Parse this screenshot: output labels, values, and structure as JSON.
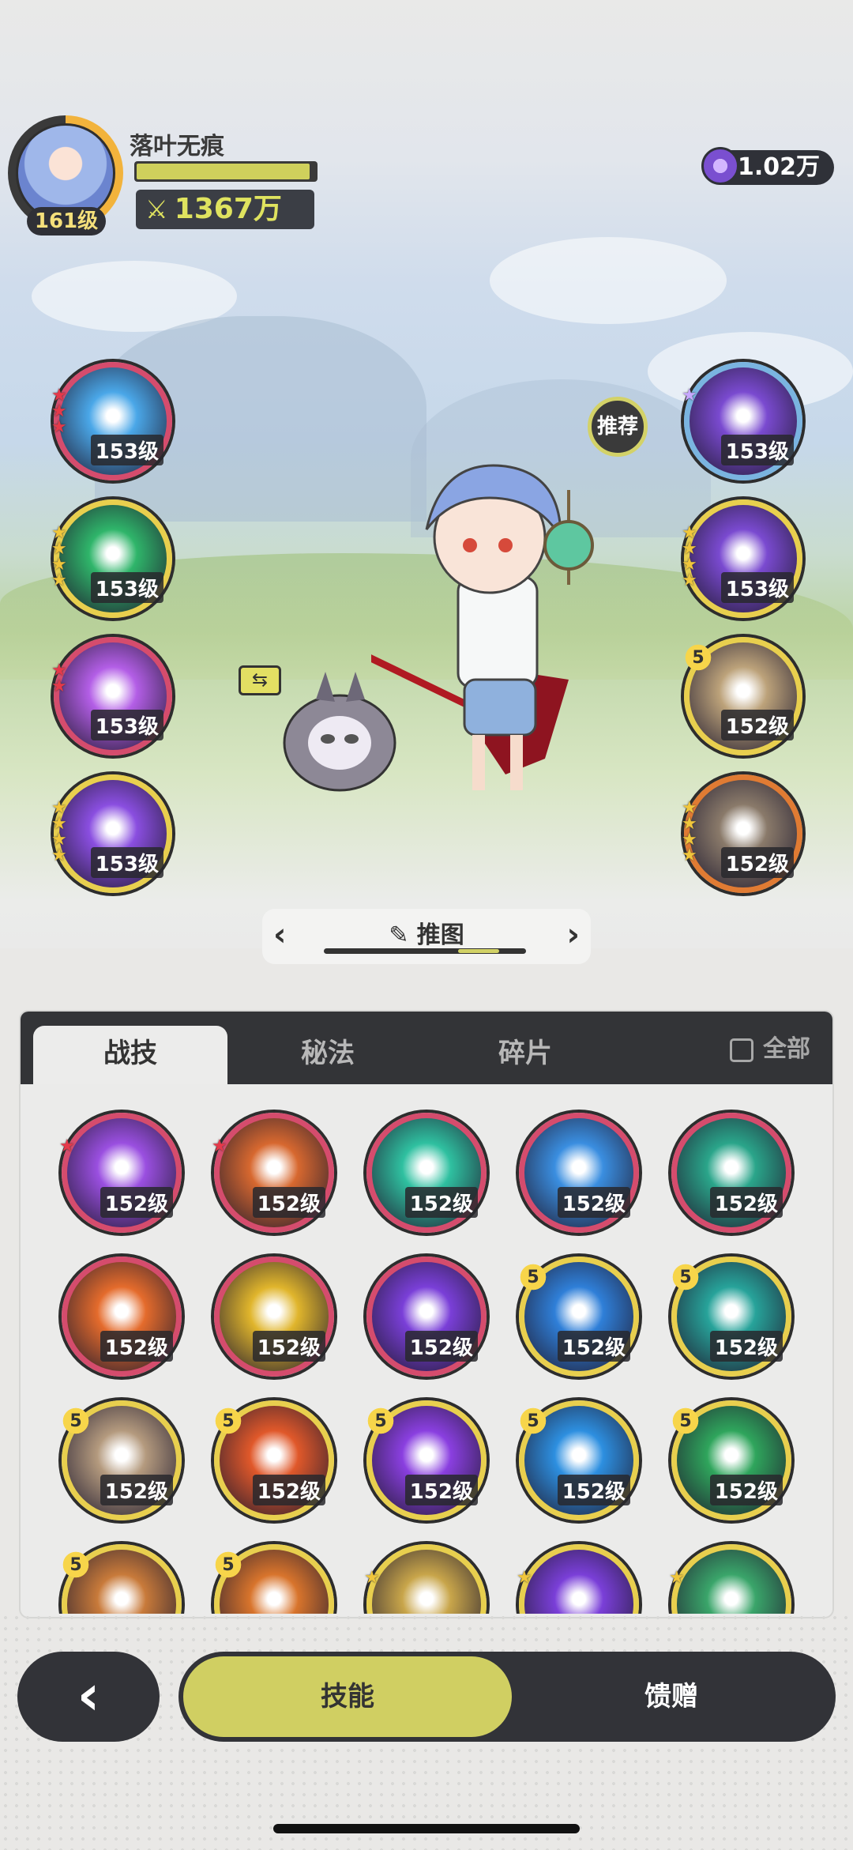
{
  "player": {
    "name": "落叶无痕",
    "level": "161级",
    "power": "1367万",
    "hp_fraction": 0.97
  },
  "currency": {
    "amount": "1.02万",
    "icon": "crystal-icon"
  },
  "recommend_label": "推荐",
  "left_skills": [
    {
      "level": "153级",
      "stars": 3,
      "star_color": "red",
      "frame": "red",
      "theme": "#4aa7e8"
    },
    {
      "level": "153级",
      "stars": 4,
      "star_color": "gold",
      "frame": "gold",
      "theme": "#2fb56a"
    },
    {
      "level": "153级",
      "stars": 2,
      "star_color": "red",
      "frame": "red",
      "theme": "#b35ee6"
    },
    {
      "level": "153级",
      "stars": 4,
      "star_color": "gold",
      "frame": "gold",
      "theme": "#8a4ee0"
    }
  ],
  "right_skills": [
    {
      "level": "153级",
      "stars": 1,
      "star_color": "purple",
      "frame": "blue",
      "theme": "#7a4ad0"
    },
    {
      "level": "153级",
      "stars": 4,
      "star_color": "gold",
      "frame": "gold",
      "theme": "#7a4ad0"
    },
    {
      "level": "152级",
      "stars": 5,
      "star_color": "gold",
      "frame": "gold",
      "theme": "#bca27a",
      "badge": "5"
    },
    {
      "level": "152级",
      "stars": 4,
      "star_color": "gold",
      "frame": "orange",
      "theme": "#8a7a6a"
    }
  ],
  "page_switch": {
    "title": "推图",
    "edit_icon": "pencil-icon"
  },
  "panel": {
    "tabs": [
      "战技",
      "秘法",
      "碎片"
    ],
    "active_tab": 0,
    "all_label": "全部",
    "grid": [
      {
        "level": "152级",
        "frame": "red",
        "theme": "#9a4fe0",
        "stars": 1,
        "star_color": "red"
      },
      {
        "level": "152级",
        "frame": "red",
        "theme": "#d7682f",
        "stars": 1,
        "star_color": "red"
      },
      {
        "level": "152级",
        "frame": "red",
        "theme": "#2fc0a0"
      },
      {
        "level": "152级",
        "frame": "red",
        "theme": "#3a8ee0"
      },
      {
        "level": "152级",
        "frame": "red",
        "theme": "#2aa58a"
      },
      {
        "level": "152级",
        "frame": "red",
        "theme": "#e46b2c"
      },
      {
        "level": "152级",
        "frame": "red",
        "theme": "#e0b52c"
      },
      {
        "level": "152级",
        "frame": "red",
        "theme": "#7a3fd8"
      },
      {
        "level": "152级",
        "frame": "gold",
        "theme": "#2f7fd8",
        "badge": "5"
      },
      {
        "level": "152级",
        "frame": "gold",
        "theme": "#27a39a",
        "badge": "5"
      },
      {
        "level": "152级",
        "frame": "gold",
        "theme": "#b49a7e",
        "badge": "5"
      },
      {
        "level": "152级",
        "frame": "gold",
        "theme": "#e0582a",
        "badge": "5"
      },
      {
        "level": "152级",
        "frame": "gold",
        "theme": "#8a3fe0",
        "badge": "5"
      },
      {
        "level": "152级",
        "frame": "gold",
        "theme": "#2d8fe0",
        "badge": "5"
      },
      {
        "level": "152级",
        "frame": "gold",
        "theme": "#2fa55c",
        "badge": "5"
      },
      {
        "level": "",
        "frame": "gold",
        "theme": "#c87a3a",
        "badge": "5"
      },
      {
        "level": "",
        "frame": "gold",
        "theme": "#d8742c",
        "badge": "5"
      },
      {
        "level": "",
        "frame": "gold",
        "theme": "#c8a54a",
        "stars": 1,
        "star_color": "gold"
      },
      {
        "level": "",
        "frame": "gold",
        "theme": "#7a3fd8",
        "stars": 1,
        "star_color": "gold"
      },
      {
        "level": "",
        "frame": "gold",
        "theme": "#3aa56a",
        "stars": 1,
        "star_color": "gold"
      }
    ]
  },
  "bottom_bar": {
    "back_icon": "chevron-left-icon",
    "tabs": [
      "技能",
      "馈赠"
    ],
    "active": 0
  }
}
